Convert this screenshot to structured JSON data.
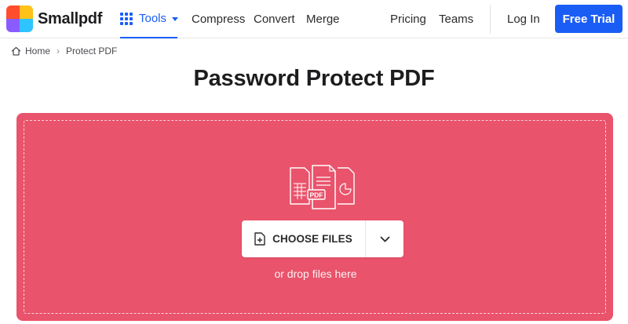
{
  "brand": {
    "name": "Smallpdf",
    "logo_colors": [
      "#ff4d2e",
      "#ffc21a",
      "#2ec4ff",
      "#8a5cff"
    ]
  },
  "nav": {
    "tools_label": "Tools",
    "compress_label": "Compress",
    "convert_label": "Convert",
    "merge_label": "Merge",
    "pricing_label": "Pricing",
    "teams_label": "Teams",
    "login_label": "Log In",
    "trial_label": "Free Trial"
  },
  "breadcrumb": {
    "home_label": "Home",
    "separator": "›",
    "current_label": "Protect PDF"
  },
  "page": {
    "title": "Password Protect PDF"
  },
  "dropzone": {
    "choose_label": "CHOOSE FILES",
    "drop_hint": "or drop files here",
    "file_badge": "PDF",
    "background_color": "#e9536b"
  },
  "colors": {
    "accent": "#1a5df5"
  }
}
